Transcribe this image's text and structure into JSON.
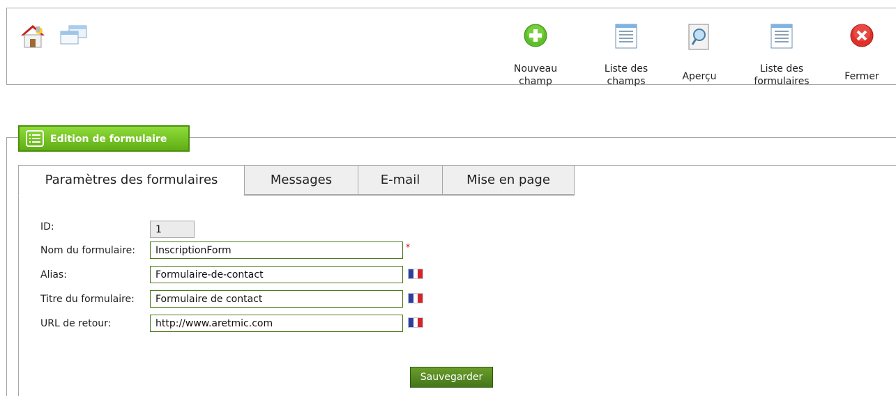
{
  "toolbar": {
    "left_icons": [
      "home-icon",
      "windows-icon"
    ],
    "buttons": [
      {
        "line1": "Nouveau",
        "line2": "champ",
        "icon": "plus-circle-icon"
      },
      {
        "line1": "Liste des",
        "line2": "champs",
        "icon": "list-icon"
      },
      {
        "line1": "Aperçu",
        "line2": "",
        "icon": "preview-icon"
      },
      {
        "line1": "Liste des",
        "line2": "formulaires",
        "icon": "list-icon"
      },
      {
        "line1": "Fermer",
        "line2": "",
        "icon": "close-circle-icon"
      }
    ]
  },
  "section": {
    "title": "Edition de formulaire",
    "icon": "form-list-icon"
  },
  "tabs": [
    {
      "label": "Paramètres des formulaires",
      "active": true
    },
    {
      "label": "Messages",
      "active": false
    },
    {
      "label": "E-mail",
      "active": false
    },
    {
      "label": "Mise en page",
      "active": false
    }
  ],
  "form": {
    "id": {
      "label": "ID:",
      "value": "1"
    },
    "name": {
      "label": "Nom du formulaire:",
      "value": "InscriptionForm",
      "required_mark": "*"
    },
    "alias": {
      "label": "Alias:",
      "value": "Formulaire-de-contact",
      "flag": "fr-flag-icon"
    },
    "title": {
      "label": "Titre du formulaire:",
      "value": "Formulaire de contact",
      "flag": "fr-flag-icon"
    },
    "return_url": {
      "label": "URL de retour:",
      "value": "http://www.aretmic.com",
      "flag": "fr-flag-icon"
    }
  },
  "save_label": "Sauvegarder",
  "colors": {
    "accent_green": "#5fae14",
    "button_green": "#44761a",
    "close_red": "#e0302a",
    "flag_blue": "#2b3fa0",
    "flag_red": "#d3262b"
  }
}
